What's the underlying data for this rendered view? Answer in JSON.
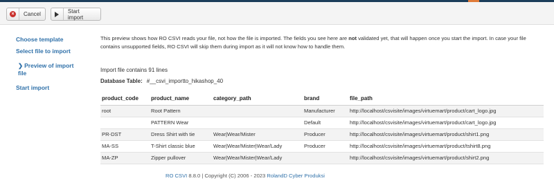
{
  "toolbar": {
    "cancel_label": "Cancel",
    "start_import_label": "Start import"
  },
  "sidebar": {
    "items": [
      {
        "label": "Choose template"
      },
      {
        "label": "Select file to import"
      },
      {
        "label": "Preview of import file"
      },
      {
        "label": "Start import"
      }
    ]
  },
  "main": {
    "intro_1": "This preview shows how RO CSVI reads your file, not how the file is imported. The fields you see here are ",
    "intro_bold": "not",
    "intro_2": " validated yet, that will happen once you start the import. In case your file contains unsupported fields, RO CSVI will skip them during import as it will not know how to handle them.",
    "line_count": "Import file contains 91 lines",
    "db_table_label": "Database Table:",
    "db_table_value": "#__csvi_importto_hikashop_40"
  },
  "table": {
    "headers": [
      "product_code",
      "product_name",
      "category_path",
      "brand",
      "file_path"
    ],
    "rows": [
      [
        "root",
        "Root Pattern",
        "",
        "Manufacturer",
        "http://localhost/csvisite/images/virtuemart/product/cart_logo.jpg"
      ],
      [
        "",
        "PATTERN Wear",
        "",
        "Default",
        "http://localhost/csvisite/images/virtuemart/product/cart_logo.jpg"
      ],
      [
        "PR-DST",
        "Dress Shirt with tie",
        "Wear|Wear/Mister",
        "Producer",
        "http://localhost/csvisite/images/virtuemart/product/shirt1.png"
      ],
      [
        "MA-SS",
        "T-Shirt classic blue",
        "Wear|Wear/Mister|Wear/Lady",
        "Producer",
        "http://localhost/csvisite/images/virtuemart/product/tshirt8.png"
      ],
      [
        "MA-ZP",
        "Zipper pullover",
        "Wear|Wear/Mister|Wear/Lady",
        "",
        "http://localhost/csvisite/images/virtuemart/product/shirt2.png"
      ]
    ]
  },
  "footer": {
    "product_link": "RO CSVI",
    "text": " 8.8.0 | Copyright (C) 2006 - 2023 ",
    "company_link": "RolandD Cyber Produksi"
  },
  "colors": {
    "link": "#3071a9",
    "cancel_icon": "#c9302c",
    "top_bar": "#1c3d5a"
  }
}
